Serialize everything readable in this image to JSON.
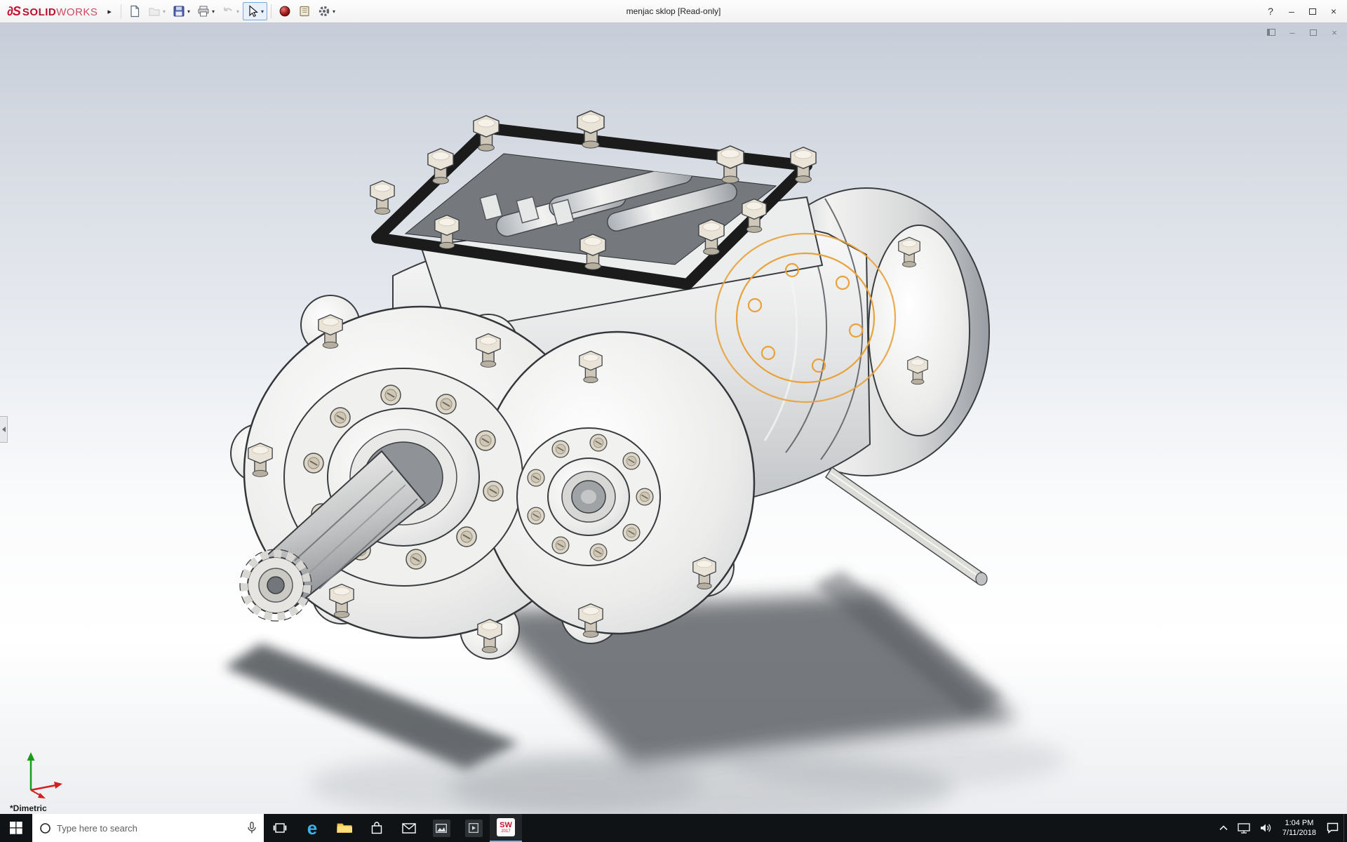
{
  "window": {
    "brand": {
      "mark": "∂S",
      "name_bold": "SOLID",
      "name_light": "WORKS"
    },
    "flyout_arrow": "▸",
    "title": "menjac sklop [Read-only]",
    "buttons": {
      "help": "?",
      "minimize": "–",
      "close": "×"
    }
  },
  "toolbar": {
    "caret": "▾",
    "items": [
      {
        "id": "new-document",
        "enabled": true,
        "has_caret": false,
        "active": false
      },
      {
        "id": "open",
        "enabled": false,
        "has_caret": true,
        "active": false
      },
      {
        "id": "save",
        "enabled": true,
        "has_caret": true,
        "active": false
      },
      {
        "id": "print",
        "enabled": true,
        "has_caret": true,
        "active": false
      },
      {
        "id": "undo",
        "enabled": false,
        "has_caret": true,
        "active": false
      },
      {
        "id": "select",
        "enabled": true,
        "has_caret": true,
        "active": true
      },
      {
        "id": "appearance-sphere",
        "enabled": true,
        "has_caret": false,
        "active": false
      },
      {
        "id": "design-binder",
        "enabled": true,
        "has_caret": false,
        "active": false
      },
      {
        "id": "options-gear",
        "enabled": true,
        "has_caret": true,
        "active": false
      }
    ]
  },
  "document_window": {
    "controls": [
      "pane-toggle",
      "minimize",
      "restore",
      "close"
    ]
  },
  "viewport": {
    "orientation_label": "*Dimetric",
    "content": "3D gearbox assembly (menjac sklop) shaded view with top cover gasket, hex bolts, twin front flanges, spline input shaft, thin output shaft, orange sketch circles on right flange",
    "sketch_highlight_color": "#E8A23C",
    "background_top": "#C7CDD8",
    "background_bottom": "#FFFFFF",
    "axis_triad_colors": {
      "x": "#d02020",
      "y": "#1a9c1a"
    }
  },
  "taskbar": {
    "search": {
      "placeholder": "Type here to search"
    },
    "apps": [
      "start",
      "search",
      "task-view",
      "edge",
      "file-explorer",
      "store",
      "mail",
      "photos",
      "media",
      "solidworks"
    ],
    "edge_glyph": "e",
    "solidworks_tile": {
      "line1": "SW",
      "line2": "2017"
    },
    "tray": {
      "icons": [
        "chevron-up",
        "ethernet",
        "volume",
        "action-center"
      ],
      "time": "1:04 PM",
      "date": "7/11/2018"
    }
  }
}
